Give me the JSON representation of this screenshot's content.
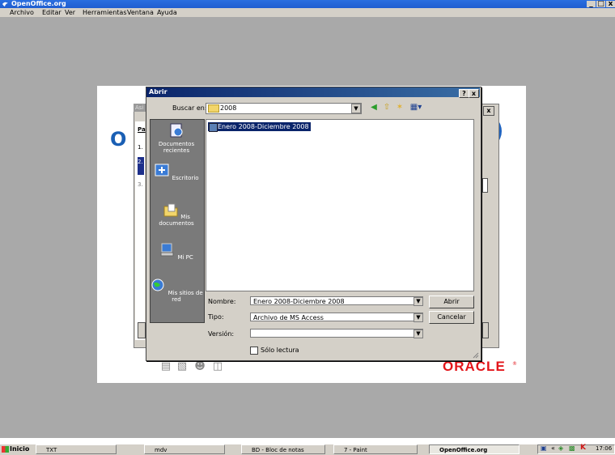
{
  "app": {
    "title": "OpenOffice.org",
    "controls": [
      "_",
      "ͦ",
      "x"
    ],
    "menu": [
      "Archivo",
      "Editar",
      "Ver",
      "Herramientas",
      "Ventana",
      "Ayuda"
    ]
  },
  "start_center": {
    "logo_letters": "O",
    "oracle": "ORACLE",
    "oracle_mark": "®"
  },
  "assistant": {
    "title": "Asi",
    "side_title": "Pa",
    "steps": [
      "1.",
      "2.",
      "3."
    ]
  },
  "dialog": {
    "title": "Abrir",
    "help": "?",
    "close": "x",
    "look_in_label": "Buscar en:",
    "look_in_value": "2008",
    "places": [
      "Documentos recientes",
      "Escritorio",
      "Mis documentos",
      "Mi PC",
      "Mis sitios de red"
    ],
    "files": [
      "Enero 2008-Diciembre 2008"
    ],
    "name_label": "Nombre:",
    "name_value": "Enero 2008-Diciembre 2008",
    "type_label": "Tipo:",
    "type_value": "Archivo de MS Access",
    "version_label": "Versión:",
    "version_value": "",
    "open_button": "Abrir",
    "cancel_button": "Cancelar",
    "readonly_label": "Sólo lectura",
    "readonly_checked": false
  },
  "taskbar": {
    "start": "Inicio",
    "tasks": [
      "TXT",
      "mdv",
      "BD - Bloc de notas",
      "7 - Paint",
      "OpenOffice.org"
    ],
    "active_task": "OpenOffice.org",
    "clock": "17:06",
    "tray_chevron": "«"
  },
  "colors": {
    "titlebar": "#2a6fe0",
    "dialog_titlebar": "#0a246a",
    "workspace": "#a9a9a9",
    "oracle_red": "#e3161b",
    "oo_blue": "#1a5fb4"
  }
}
